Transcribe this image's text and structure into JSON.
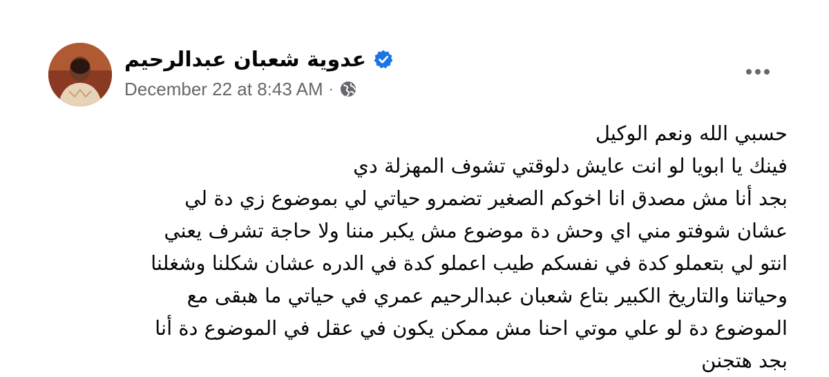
{
  "post": {
    "author_name": "عدوية شعبان عبدالرحيم",
    "verified": true,
    "timestamp": "December 22 at 8:43 AM",
    "separator": "·",
    "audience_icon": "globe-icon",
    "more_icon": "more-options-icon",
    "body_lines": [
      "حسبي الله ونعم الوكيل",
      "فينك يا ابويا لو انت عايش دلوقتي تشوف المهزلة دي",
      "بجد أنا مش مصدق انا اخوكم الصغير تضمرو حياتي لي بموضوع زي دة لي",
      "عشان شوفتو مني اي وحش دة موضوع مش يكبر مننا ولا حاجة تشرف يعني",
      "انتو لي بتعملو كدة في نفسكم طيب اعملو كدة في الدره عشان شكلنا وشغلنا",
      "وحياتنا والتاريخ الكبير بتاع شعبان عبدالرحيم عمري في حياتي ما هبقى مع",
      "الموضوع دة لو علي موتي احنا مش ممكن يكون في عقل في الموضوع دة أنا",
      "بجد هتجنن"
    ]
  },
  "colors": {
    "verified_badge": "#1b74e4",
    "secondary_text": "#65676b",
    "primary_text": "#050505"
  }
}
